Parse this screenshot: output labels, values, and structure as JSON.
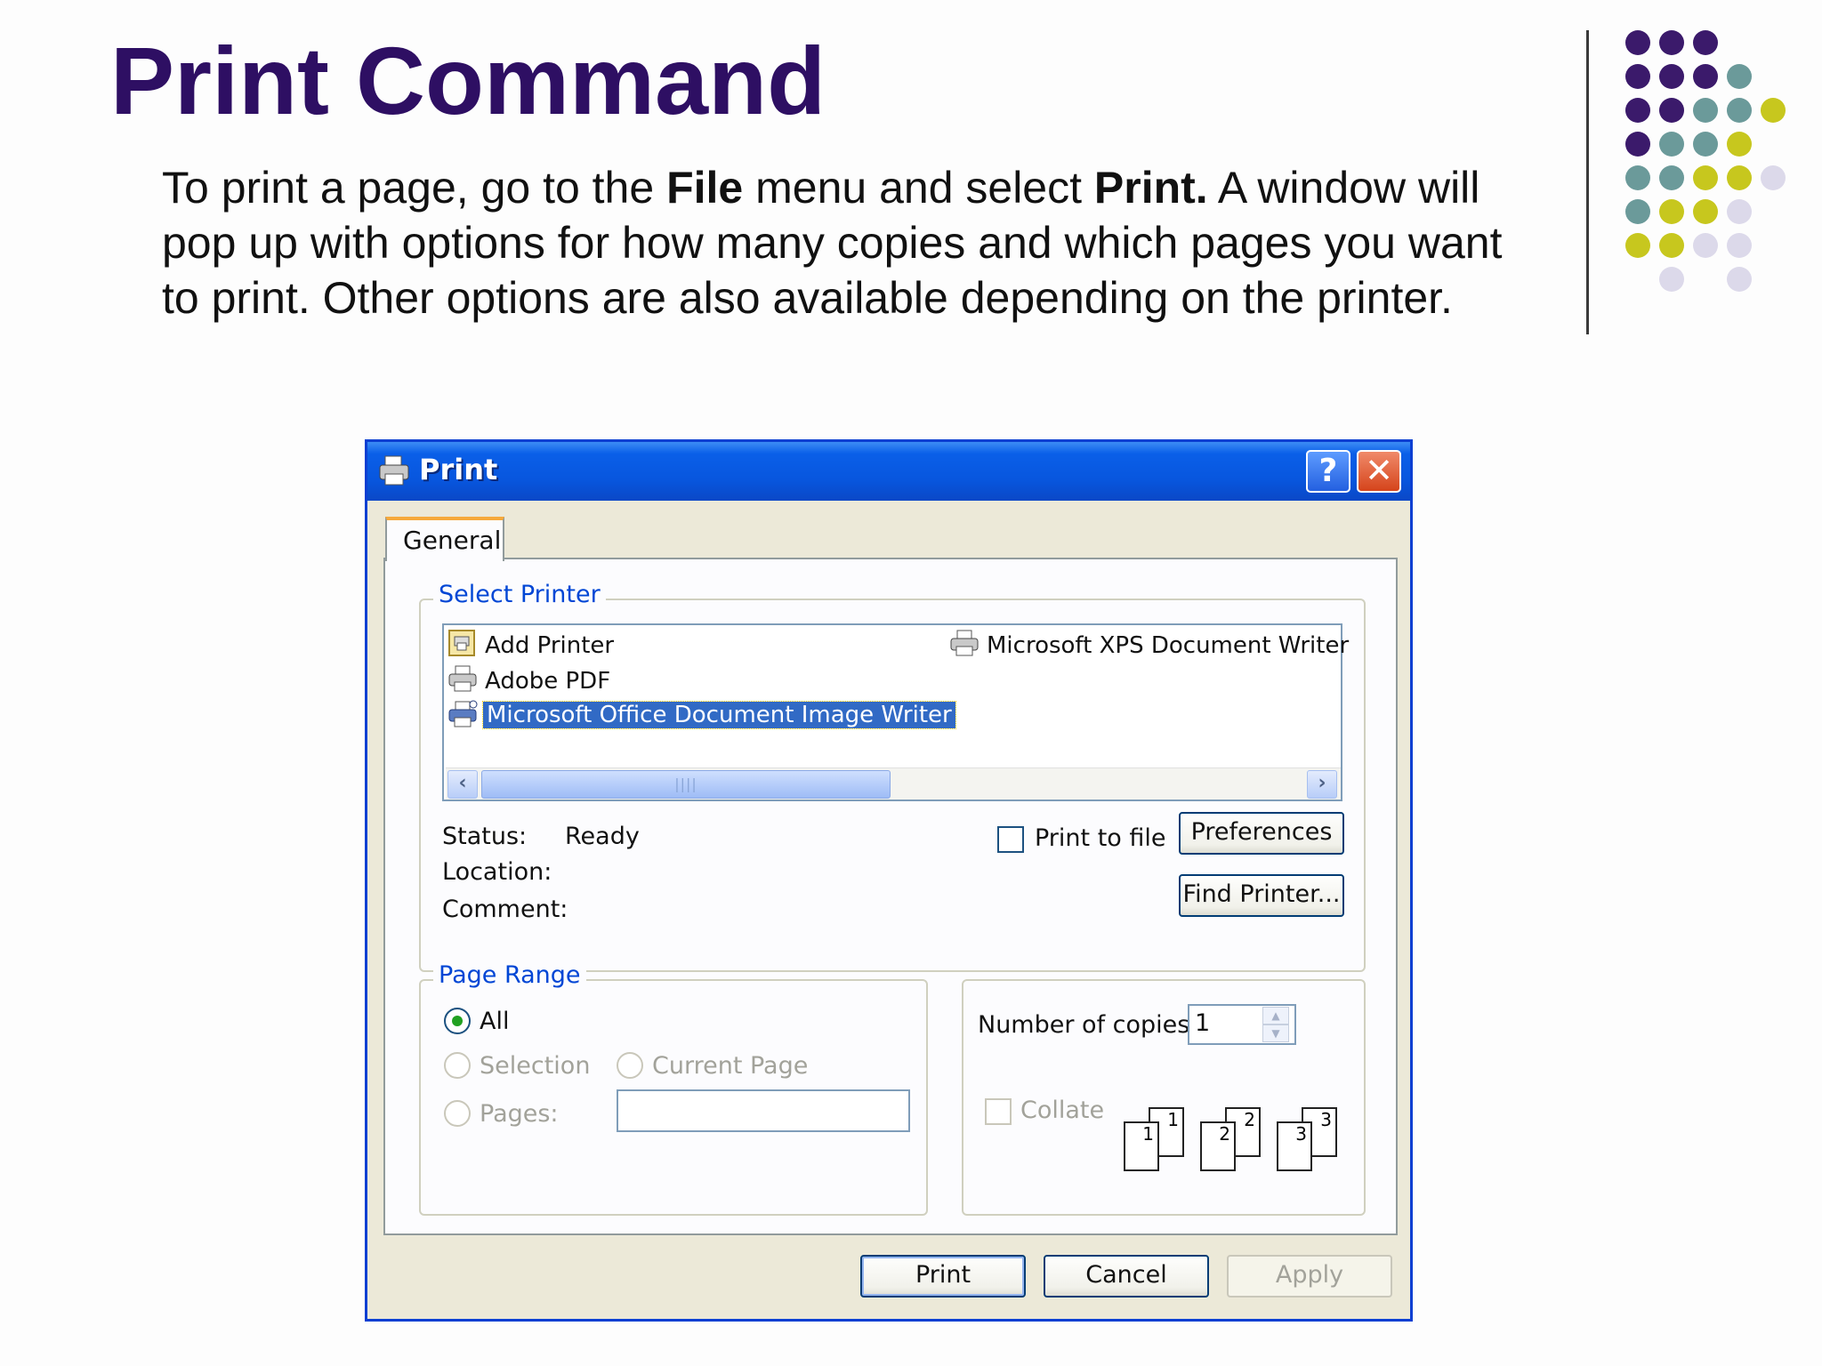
{
  "slide": {
    "title": "Print Command",
    "paragraph": {
      "p1": "To print a page, go to the ",
      "b1": "File",
      "p2": " menu and select ",
      "b2": "Print.",
      "p3": "  A window will pop up with options for how many copies and which pages you want to print.  Other options are also available depending on the printer."
    },
    "dot_colors": [
      "#3b1a6b",
      "#6b9a9a",
      "#c7c71e",
      "#dcd9ea"
    ]
  },
  "dialog": {
    "title": "Print",
    "help_glyph": "?",
    "close_glyph": "✕",
    "tab_general": "General",
    "select_printer": {
      "legend": "Select Printer",
      "printers": [
        {
          "name": "Add Printer",
          "icon": "add-printer-icon",
          "selected": false
        },
        {
          "name": "Adobe PDF",
          "icon": "printer-icon",
          "selected": false
        },
        {
          "name": "Microsoft Office Document Image Writer",
          "icon": "printer-icon",
          "selected": true
        },
        {
          "name": "Microsoft XPS Document Writer",
          "icon": "printer-icon",
          "selected": false
        }
      ],
      "status_label": "Status:",
      "status_value": "Ready",
      "location_label": "Location:",
      "comment_label": "Comment:",
      "print_to_file": "Print to file",
      "preferences": "Preferences",
      "find_printer": "Find Printer..."
    },
    "page_range": {
      "legend": "Page Range",
      "all": "All",
      "selection": "Selection",
      "current_page": "Current Page",
      "pages": "Pages:",
      "selected_option": "All"
    },
    "copies": {
      "label": "Number of copies:",
      "value": "1",
      "collate": "Collate",
      "collate_pages": [
        "1",
        "1",
        "2",
        "2",
        "3",
        "3"
      ]
    },
    "buttons": {
      "print": "Print",
      "cancel": "Cancel",
      "apply": "Apply"
    },
    "colors": {
      "titlebar": "#0a5fe8",
      "dialog_bg": "#ece9d8",
      "selection": "#316ac5",
      "group_title": "#0046d5"
    }
  }
}
